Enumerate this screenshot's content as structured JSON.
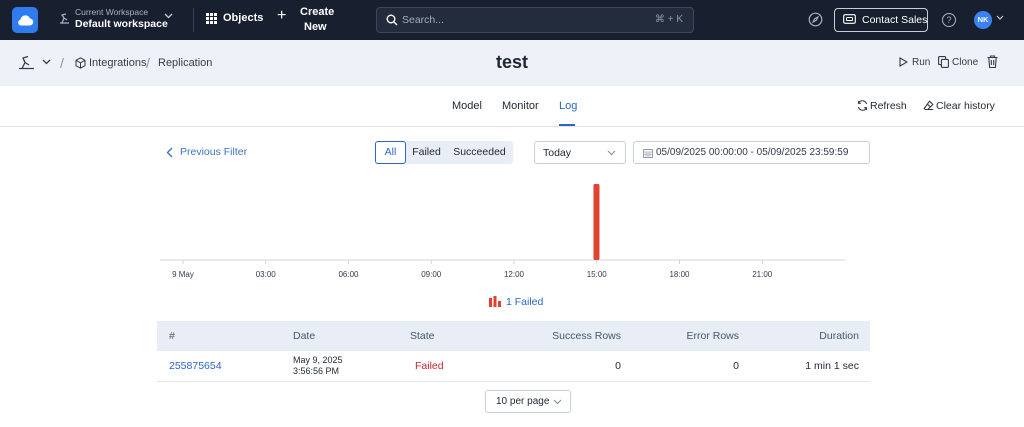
{
  "topbar": {
    "logo": "cloud-icon",
    "workspace": {
      "sub": "Current Workspace",
      "name": "Default workspace"
    },
    "objects_label": "Objects",
    "create": {
      "line1": "Create",
      "line2": "New"
    },
    "search": {
      "placeholder": "Search...",
      "shortcut": "⌘ + K"
    },
    "contact_sales": "Contact Sales",
    "help": "?",
    "avatar": "NK"
  },
  "breadcrumb": {
    "items": [
      "Integrations",
      "Replication"
    ],
    "separator": "/"
  },
  "page": {
    "title": "test"
  },
  "actions": {
    "run": "Run",
    "clone": "Clone"
  },
  "tabs": [
    {
      "label": "Model"
    },
    {
      "label": "Monitor"
    },
    {
      "label": "Log",
      "active": true
    }
  ],
  "tab_actions": {
    "refresh": "Refresh",
    "clear_history": "Clear history"
  },
  "filters": {
    "previous": "Previous Filter",
    "status": [
      "All",
      "Failed",
      "Succeeded"
    ],
    "status_selected": "All",
    "period": "Today",
    "date_range": "05/09/2025 00:00:00 - 05/09/2025 23:59:59"
  },
  "chart_data": {
    "type": "bar",
    "x_ticks": [
      "9 May",
      "03:00",
      "06:00",
      "09:00",
      "12:00",
      "15:00",
      "18:00",
      "21:00"
    ],
    "x_range_hours": [
      0,
      24
    ],
    "series": [
      {
        "name": "Failed",
        "color": "#e0432f",
        "points": [
          {
            "x_hour": 14.99,
            "value": 1
          }
        ]
      }
    ],
    "legend": "1 Failed",
    "legend_placement": "bottom-center",
    "grid": false
  },
  "table": {
    "headers": [
      "#",
      "Date",
      "State",
      "Success Rows",
      "Error Rows",
      "Duration"
    ],
    "rows": [
      {
        "id": "255875654",
        "date": "May 9, 2025",
        "time": "3:56:56 PM",
        "state": "Failed",
        "success_rows": "0",
        "error_rows": "0",
        "duration": "1 min 1 sec"
      }
    ]
  },
  "pagination": {
    "per_page": "10 per page"
  },
  "colors": {
    "accent": "#2a66c9",
    "failed": "#e0432f",
    "topbar": "#18202f"
  }
}
